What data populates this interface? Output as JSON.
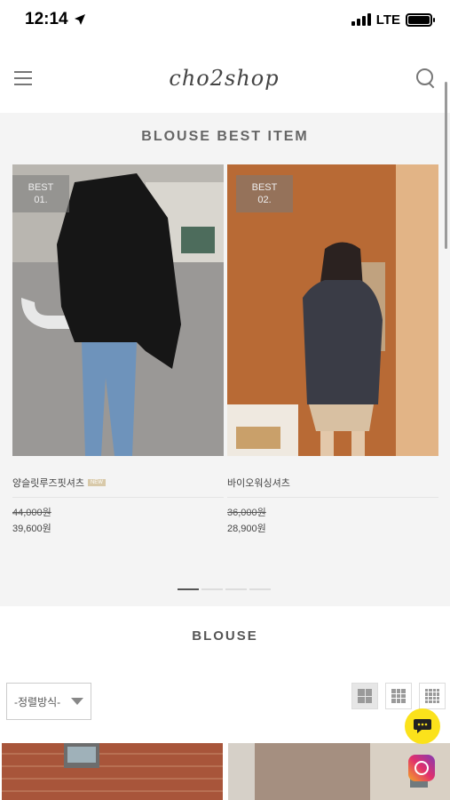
{
  "status_bar": {
    "time": "12:14",
    "network": "LTE"
  },
  "header": {
    "logo": "cho2shop"
  },
  "best_section": {
    "title": "BLOUSE BEST ITEM",
    "items": [
      {
        "badge": "BEST",
        "rank": "01.",
        "name": "양슬릿루즈핏셔츠",
        "tag": "NEW",
        "original_price": "44,000원",
        "sale_price": "39,600원"
      },
      {
        "badge": "BEST",
        "rank": "02.",
        "name": "바이오워싱셔츠",
        "original_price": "36,000원",
        "sale_price": "28,900원"
      }
    ],
    "slider": {
      "pages": 4,
      "current": 1
    }
  },
  "category": {
    "title": "BLOUSE",
    "sort_label": "-정렬방식-",
    "views": [
      {
        "icon": "grid-2-icon",
        "active": true
      },
      {
        "icon": "grid-3-icon",
        "active": false
      },
      {
        "icon": "grid-4-icon",
        "active": false
      }
    ]
  },
  "floating": {
    "chat_icon": "chat-bubble-icon",
    "instagram_icon": "instagram-icon"
  },
  "colors": {
    "accent_chat": "#fbe21b",
    "section_bg": "#f4f4f4",
    "badge_bg": "#787878"
  }
}
